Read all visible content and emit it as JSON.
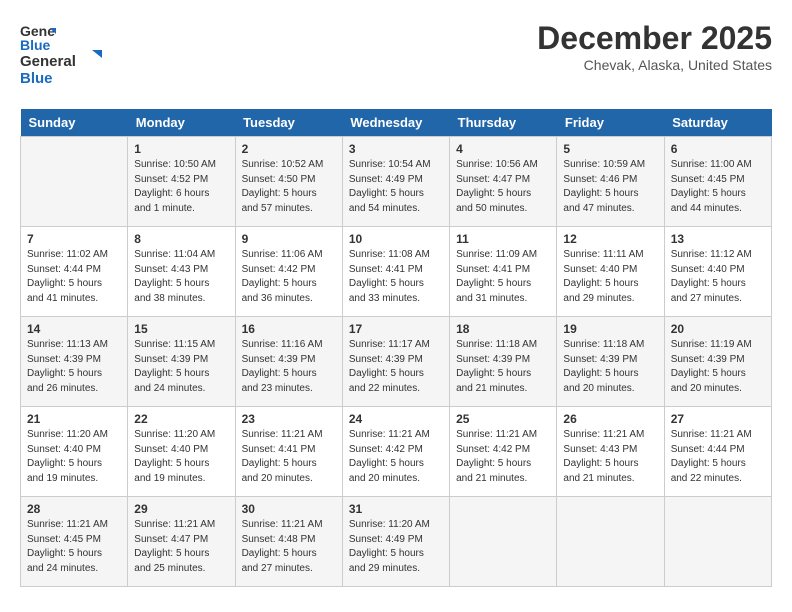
{
  "logo": {
    "general": "General",
    "blue": "Blue"
  },
  "title": {
    "month_year": "December 2025",
    "location": "Chevak, Alaska, United States"
  },
  "weekdays": [
    "Sunday",
    "Monday",
    "Tuesday",
    "Wednesday",
    "Thursday",
    "Friday",
    "Saturday"
  ],
  "weeks": [
    [
      {
        "day": "",
        "info": ""
      },
      {
        "day": "1",
        "info": "Sunrise: 10:50 AM\nSunset: 4:52 PM\nDaylight: 6 hours\nand 1 minute."
      },
      {
        "day": "2",
        "info": "Sunrise: 10:52 AM\nSunset: 4:50 PM\nDaylight: 5 hours\nand 57 minutes."
      },
      {
        "day": "3",
        "info": "Sunrise: 10:54 AM\nSunset: 4:49 PM\nDaylight: 5 hours\nand 54 minutes."
      },
      {
        "day": "4",
        "info": "Sunrise: 10:56 AM\nSunset: 4:47 PM\nDaylight: 5 hours\nand 50 minutes."
      },
      {
        "day": "5",
        "info": "Sunrise: 10:59 AM\nSunset: 4:46 PM\nDaylight: 5 hours\nand 47 minutes."
      },
      {
        "day": "6",
        "info": "Sunrise: 11:00 AM\nSunset: 4:45 PM\nDaylight: 5 hours\nand 44 minutes."
      }
    ],
    [
      {
        "day": "7",
        "info": "Sunrise: 11:02 AM\nSunset: 4:44 PM\nDaylight: 5 hours\nand 41 minutes."
      },
      {
        "day": "8",
        "info": "Sunrise: 11:04 AM\nSunset: 4:43 PM\nDaylight: 5 hours\nand 38 minutes."
      },
      {
        "day": "9",
        "info": "Sunrise: 11:06 AM\nSunset: 4:42 PM\nDaylight: 5 hours\nand 36 minutes."
      },
      {
        "day": "10",
        "info": "Sunrise: 11:08 AM\nSunset: 4:41 PM\nDaylight: 5 hours\nand 33 minutes."
      },
      {
        "day": "11",
        "info": "Sunrise: 11:09 AM\nSunset: 4:41 PM\nDaylight: 5 hours\nand 31 minutes."
      },
      {
        "day": "12",
        "info": "Sunrise: 11:11 AM\nSunset: 4:40 PM\nDaylight: 5 hours\nand 29 minutes."
      },
      {
        "day": "13",
        "info": "Sunrise: 11:12 AM\nSunset: 4:40 PM\nDaylight: 5 hours\nand 27 minutes."
      }
    ],
    [
      {
        "day": "14",
        "info": "Sunrise: 11:13 AM\nSunset: 4:39 PM\nDaylight: 5 hours\nand 26 minutes."
      },
      {
        "day": "15",
        "info": "Sunrise: 11:15 AM\nSunset: 4:39 PM\nDaylight: 5 hours\nand 24 minutes."
      },
      {
        "day": "16",
        "info": "Sunrise: 11:16 AM\nSunset: 4:39 PM\nDaylight: 5 hours\nand 23 minutes."
      },
      {
        "day": "17",
        "info": "Sunrise: 11:17 AM\nSunset: 4:39 PM\nDaylight: 5 hours\nand 22 minutes."
      },
      {
        "day": "18",
        "info": "Sunrise: 11:18 AM\nSunset: 4:39 PM\nDaylight: 5 hours\nand 21 minutes."
      },
      {
        "day": "19",
        "info": "Sunrise: 11:18 AM\nSunset: 4:39 PM\nDaylight: 5 hours\nand 20 minutes."
      },
      {
        "day": "20",
        "info": "Sunrise: 11:19 AM\nSunset: 4:39 PM\nDaylight: 5 hours\nand 20 minutes."
      }
    ],
    [
      {
        "day": "21",
        "info": "Sunrise: 11:20 AM\nSunset: 4:40 PM\nDaylight: 5 hours\nand 19 minutes."
      },
      {
        "day": "22",
        "info": "Sunrise: 11:20 AM\nSunset: 4:40 PM\nDaylight: 5 hours\nand 19 minutes."
      },
      {
        "day": "23",
        "info": "Sunrise: 11:21 AM\nSunset: 4:41 PM\nDaylight: 5 hours\nand 20 minutes."
      },
      {
        "day": "24",
        "info": "Sunrise: 11:21 AM\nSunset: 4:42 PM\nDaylight: 5 hours\nand 20 minutes."
      },
      {
        "day": "25",
        "info": "Sunrise: 11:21 AM\nSunset: 4:42 PM\nDaylight: 5 hours\nand 21 minutes."
      },
      {
        "day": "26",
        "info": "Sunrise: 11:21 AM\nSunset: 4:43 PM\nDaylight: 5 hours\nand 21 minutes."
      },
      {
        "day": "27",
        "info": "Sunrise: 11:21 AM\nSunset: 4:44 PM\nDaylight: 5 hours\nand 22 minutes."
      }
    ],
    [
      {
        "day": "28",
        "info": "Sunrise: 11:21 AM\nSunset: 4:45 PM\nDaylight: 5 hours\nand 24 minutes."
      },
      {
        "day": "29",
        "info": "Sunrise: 11:21 AM\nSunset: 4:47 PM\nDaylight: 5 hours\nand 25 minutes."
      },
      {
        "day": "30",
        "info": "Sunrise: 11:21 AM\nSunset: 4:48 PM\nDaylight: 5 hours\nand 27 minutes."
      },
      {
        "day": "31",
        "info": "Sunrise: 11:20 AM\nSunset: 4:49 PM\nDaylight: 5 hours\nand 29 minutes."
      },
      {
        "day": "",
        "info": ""
      },
      {
        "day": "",
        "info": ""
      },
      {
        "day": "",
        "info": ""
      }
    ]
  ]
}
